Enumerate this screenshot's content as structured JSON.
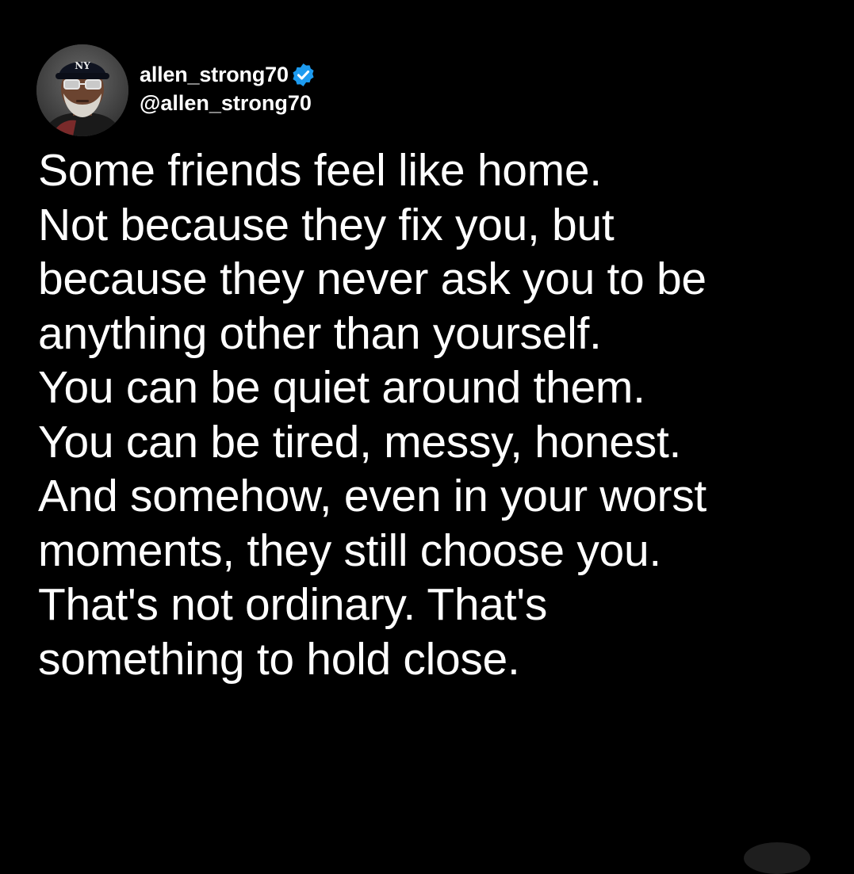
{
  "theme": {
    "background": "#000000",
    "text": "#ffffff",
    "verified_badge": "#1d9bf0"
  },
  "author": {
    "display_name": "allen_strong70",
    "handle": "@allen_strong70",
    "verified": true,
    "verified_icon": "verified-check-icon",
    "avatar_icon": "user-avatar"
  },
  "post": {
    "lines": [
      "Some friends feel like home.",
      "Not because they fix you, but",
      "because they never ask you to be",
      "anything other than yourself.",
      "You can be quiet around them.",
      "You can be tired, messy, honest.",
      "And somehow, even in your worst",
      "moments, they still choose you.",
      "That's not ordinary. That's",
      "something to hold close."
    ]
  }
}
